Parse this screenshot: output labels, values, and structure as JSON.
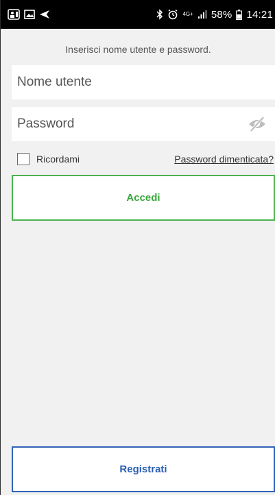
{
  "status_bar": {
    "left_icons": [
      "sim-notification-icon",
      "image-icon",
      "send-icon"
    ],
    "right_icons": [
      "bluetooth-icon",
      "alarm-icon",
      "signal-icon",
      "battery-icon"
    ],
    "network": "4G+",
    "battery_percent": "58%",
    "time": "14:21"
  },
  "login": {
    "instruction": "Inserisci nome utente e password.",
    "username_placeholder": "Nome utente",
    "username_value": "",
    "password_placeholder": "Password",
    "password_value": "",
    "remember_label": "Ricordami",
    "remember_checked": false,
    "forgot_link": "Password dimenticata?",
    "login_button": "Accedi",
    "register_button": "Registrati"
  },
  "colors": {
    "login_accent": "#4cb34f",
    "register_accent": "#2f62b8",
    "background": "#f1f1f1"
  }
}
